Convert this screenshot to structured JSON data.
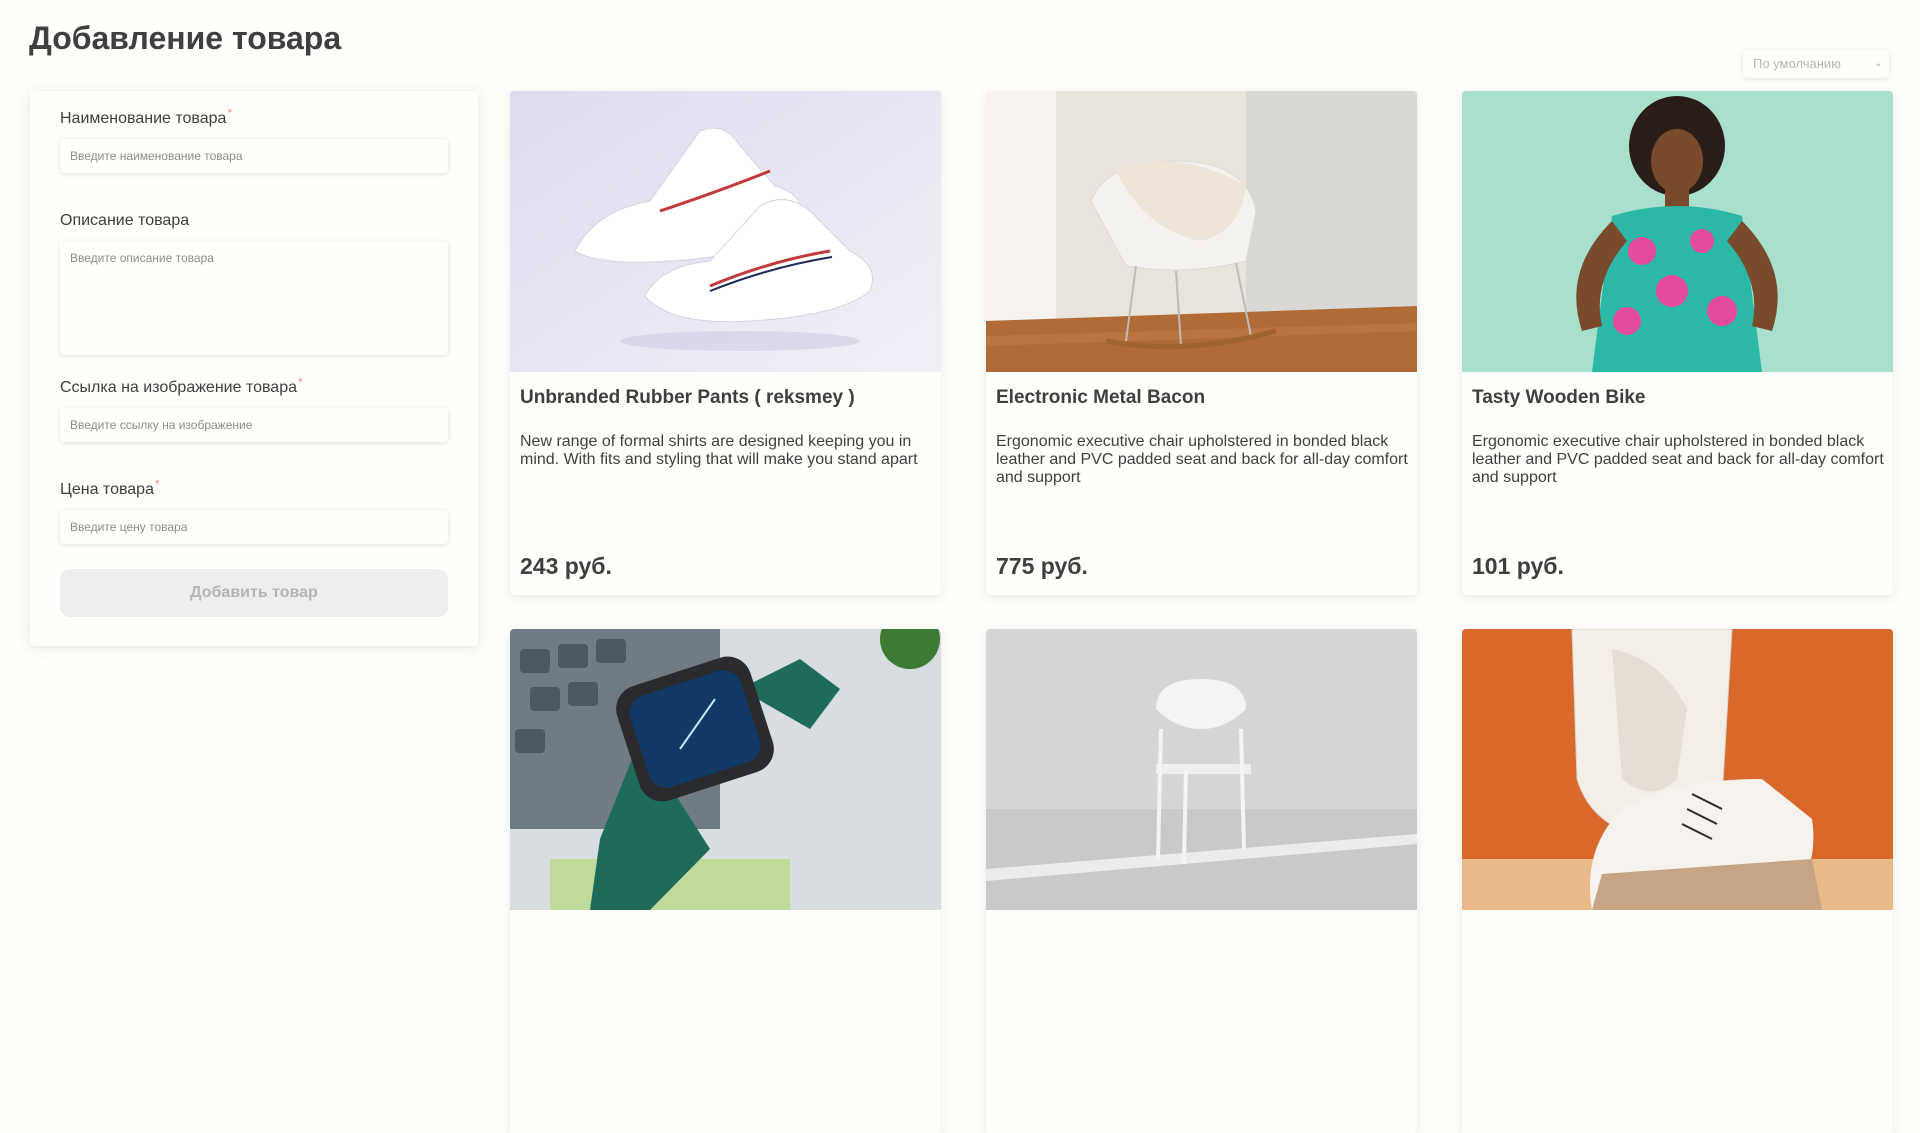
{
  "page": {
    "title": "Добавление товара"
  },
  "form": {
    "name": {
      "label": "Наименование товара",
      "placeholder": "Введите наименование товара"
    },
    "description": {
      "label": "Описание товара",
      "placeholder": "Введите описание товара"
    },
    "image": {
      "label": "Ссылка на изображение товара",
      "placeholder": "Введите ссылку на изображение"
    },
    "price": {
      "label": "Цена товара",
      "placeholder": "Введите цену товара"
    },
    "required_mark": "*",
    "submit_label": "Добавить товар"
  },
  "sort": {
    "selected": "По умолчанию"
  },
  "products": [
    {
      "title": "Unbranded Rubber Pants ( reksmey )",
      "description": "New range of formal shirts are designed keeping you in mind. With fits and styling that will make you stand apart",
      "price": "243 руб.",
      "image": "sneakers-image"
    },
    {
      "title": "Electronic Metal Bacon",
      "description": "Ergonomic executive chair upholstered in bonded black leather and PVC padded seat and back for all-day comfort and support",
      "price": "775 руб.",
      "image": "chair-image"
    },
    {
      "title": "Tasty Wooden Bike",
      "description": "Ergonomic executive chair upholstered in bonded black leather and PVC padded seat and back for all-day comfort and support",
      "price": "101 руб.",
      "image": "dress-image"
    },
    {
      "image": "watch-image"
    },
    {
      "image": "white-chair-image"
    },
    {
      "image": "orange-sneaker-image"
    }
  ],
  "colors": {
    "background": "#fffefb",
    "text": "#3f3f3f",
    "required": "#ff8a8a",
    "button_bg": "#eeeeee",
    "button_text": "#b4b4b4"
  }
}
